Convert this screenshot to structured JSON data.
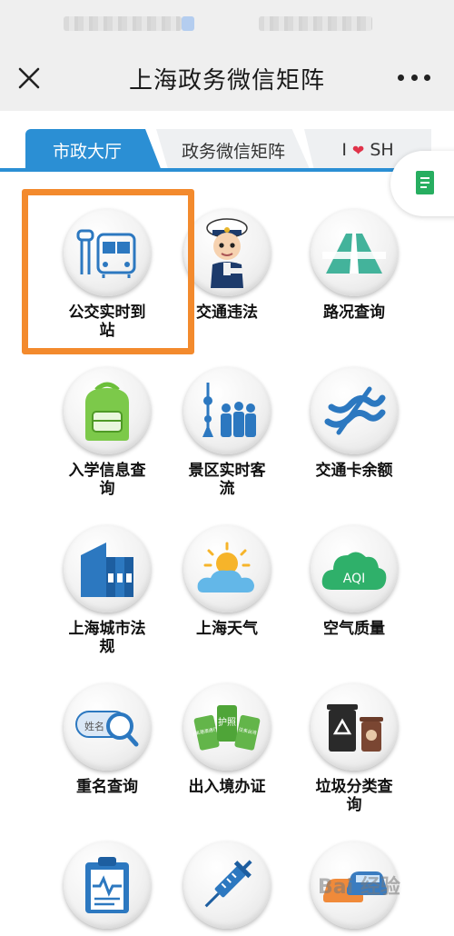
{
  "navbar": {
    "title": "上海政务微信矩阵"
  },
  "tabs": [
    {
      "label": "市政大厅",
      "active": true
    },
    {
      "label": "政务微信矩阵",
      "active": false
    },
    {
      "label_prefix": "I",
      "label_suffix": "SH",
      "heart_icon": "heart-icon",
      "active": false
    }
  ],
  "colors": {
    "accent": "#2b8fd4",
    "highlight": "#f38a2d",
    "heart": "#e0334a"
  },
  "grid": [
    {
      "label": "公交实时到站",
      "icon": "bus-stop-icon"
    },
    {
      "label": "交通违法",
      "icon": "traffic-police-icon"
    },
    {
      "label": "路况查询",
      "icon": "road-icon"
    },
    {
      "label": "入学信息查询",
      "icon": "backpack-icon"
    },
    {
      "label": "景区实时客流",
      "icon": "crowd-tower-icon"
    },
    {
      "label": "交通卡余额",
      "icon": "transit-card-icon"
    },
    {
      "label": "上海城市法规",
      "icon": "law-books-icon"
    },
    {
      "label": "上海天气",
      "icon": "weather-icon"
    },
    {
      "label": "空气质量",
      "icon": "aqi-cloud-icon"
    },
    {
      "label": "重名查询",
      "icon": "name-search-icon"
    },
    {
      "label": "出入境办证",
      "icon": "passport-cards-icon"
    },
    {
      "label": "垃圾分类查询",
      "icon": "trash-bins-icon"
    },
    {
      "label": "",
      "icon": "clipboard-health-icon"
    },
    {
      "label": "",
      "icon": "syringe-icon"
    },
    {
      "label": "",
      "icon": "cars-icon"
    }
  ],
  "icon_texts": {
    "aqi": "AQI",
    "name_tag": "姓名",
    "card_1": "护照",
    "card_2": "往来港澳通行证",
    "card_3": "往来台湾"
  },
  "watermark": "Bai 经验"
}
